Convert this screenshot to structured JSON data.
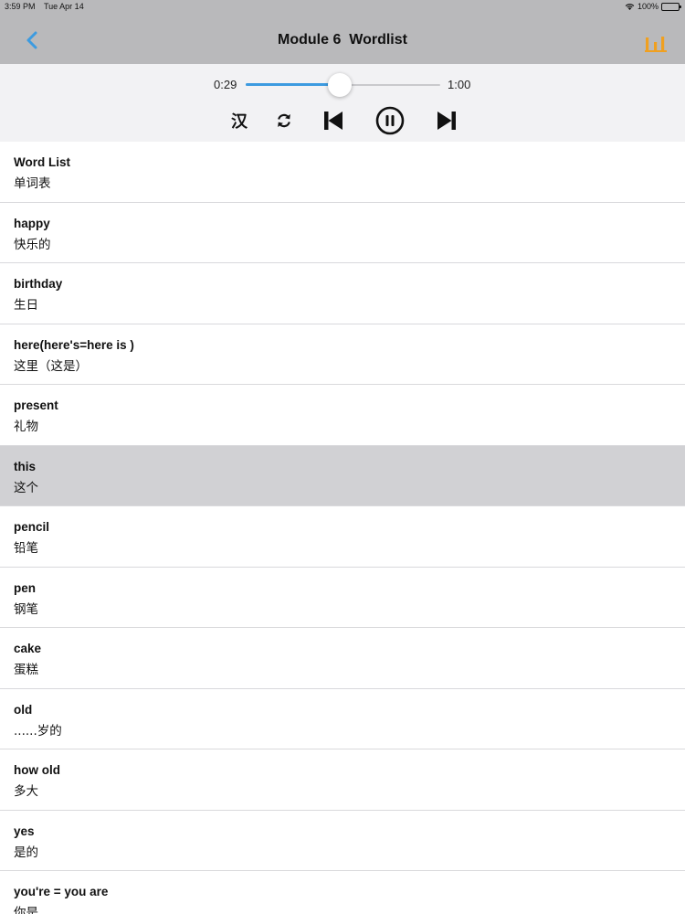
{
  "status_bar": {
    "time": "3:59 PM",
    "date": "Tue Apr 14",
    "battery_text": "100%",
    "wifi_icon": "wifi-icon",
    "battery_icon": "battery-icon"
  },
  "nav": {
    "title": "Module 6  Wordlist",
    "back_icon": "chevron-left-icon",
    "menu_icon": "bars-icon",
    "accent_color": "#3d9be0",
    "menu_color": "#f0a020"
  },
  "player": {
    "current_time": "0:29",
    "total_time": "1:00",
    "progress": 0.483,
    "hanzi_label": "汉",
    "controls": [
      "hanzi-toggle",
      "repeat-icon",
      "previous-icon",
      "pause-icon",
      "next-icon"
    ]
  },
  "words": [
    {
      "en": "Word List",
      "zh": "单词表",
      "selected": false
    },
    {
      "en": "happy",
      "zh": "快乐的",
      "selected": false
    },
    {
      "en": "birthday",
      "zh": "生日",
      "selected": false
    },
    {
      "en": "here(here's=here is )",
      "zh": "这里（这是）",
      "selected": false
    },
    {
      "en": "present",
      "zh": "礼物",
      "selected": false
    },
    {
      "en": "this",
      "zh": "这个",
      "selected": true
    },
    {
      "en": "pencil",
      "zh": "铅笔",
      "selected": false
    },
    {
      "en": "pen",
      "zh": "钢笔",
      "selected": false
    },
    {
      "en": "cake",
      "zh": "蛋糕",
      "selected": false
    },
    {
      "en": "old",
      "zh": "......岁的",
      "selected": false
    },
    {
      "en": "how old",
      "zh": "多大",
      "selected": false
    },
    {
      "en": "yes",
      "zh": "是的",
      "selected": false
    },
    {
      "en": "you're = you are",
      "zh": "你是",
      "selected": false
    }
  ]
}
